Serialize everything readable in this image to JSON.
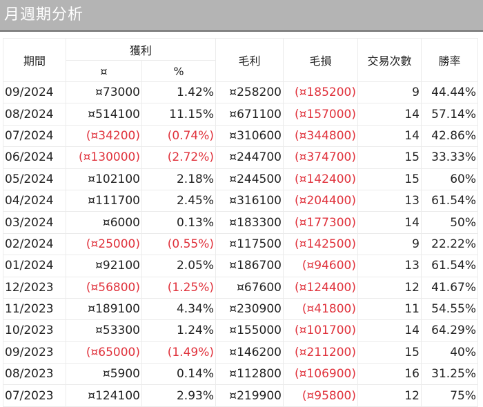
{
  "title": "月週期分析",
  "headers": {
    "period": "期間",
    "profit": "獲利",
    "profit_amount": "¤",
    "profit_pct": "%",
    "gross_profit": "毛利",
    "gross_loss": "毛損",
    "trades": "交易次數",
    "win_rate": "勝率"
  },
  "colors": {
    "negative": "#e0323c",
    "title_bg": "#b4b4b4"
  },
  "rows": [
    {
      "period": "09/2024",
      "amount": "¤73000",
      "pct": "1.42%",
      "gp": "¤258200",
      "gl": "(¤185200)",
      "trades": "9",
      "win": "44.44%",
      "neg": false
    },
    {
      "period": "08/2024",
      "amount": "¤514100",
      "pct": "11.15%",
      "gp": "¤671100",
      "gl": "(¤157000)",
      "trades": "14",
      "win": "57.14%",
      "neg": false
    },
    {
      "period": "07/2024",
      "amount": "(¤34200)",
      "pct": "(0.74%)",
      "gp": "¤310600",
      "gl": "(¤344800)",
      "trades": "14",
      "win": "42.86%",
      "neg": true
    },
    {
      "period": "06/2024",
      "amount": "(¤130000)",
      "pct": "(2.72%)",
      "gp": "¤244700",
      "gl": "(¤374700)",
      "trades": "15",
      "win": "33.33%",
      "neg": true
    },
    {
      "period": "05/2024",
      "amount": "¤102100",
      "pct": "2.18%",
      "gp": "¤244500",
      "gl": "(¤142400)",
      "trades": "15",
      "win": "60%",
      "neg": false
    },
    {
      "period": "04/2024",
      "amount": "¤111700",
      "pct": "2.45%",
      "gp": "¤316100",
      "gl": "(¤204400)",
      "trades": "13",
      "win": "61.54%",
      "neg": false
    },
    {
      "period": "03/2024",
      "amount": "¤6000",
      "pct": "0.13%",
      "gp": "¤183300",
      "gl": "(¤177300)",
      "trades": "14",
      "win": "50%",
      "neg": false
    },
    {
      "period": "02/2024",
      "amount": "(¤25000)",
      "pct": "(0.55%)",
      "gp": "¤117500",
      "gl": "(¤142500)",
      "trades": "9",
      "win": "22.22%",
      "neg": true
    },
    {
      "period": "01/2024",
      "amount": "¤92100",
      "pct": "2.05%",
      "gp": "¤186700",
      "gl": "(¤94600)",
      "trades": "13",
      "win": "61.54%",
      "neg": false
    },
    {
      "period": "12/2023",
      "amount": "(¤56800)",
      "pct": "(1.25%)",
      "gp": "¤67600",
      "gl": "(¤124400)",
      "trades": "12",
      "win": "41.67%",
      "neg": true
    },
    {
      "period": "11/2023",
      "amount": "¤189100",
      "pct": "4.34%",
      "gp": "¤230900",
      "gl": "(¤41800)",
      "trades": "11",
      "win": "54.55%",
      "neg": false
    },
    {
      "period": "10/2023",
      "amount": "¤53300",
      "pct": "1.24%",
      "gp": "¤155000",
      "gl": "(¤101700)",
      "trades": "14",
      "win": "64.29%",
      "neg": false
    },
    {
      "period": "09/2023",
      "amount": "(¤65000)",
      "pct": "(1.49%)",
      "gp": "¤146200",
      "gl": "(¤211200)",
      "trades": "15",
      "win": "40%",
      "neg": true
    },
    {
      "period": "08/2023",
      "amount": "¤5900",
      "pct": "0.14%",
      "gp": "¤112800",
      "gl": "(¤106900)",
      "trades": "16",
      "win": "31.25%",
      "neg": false
    },
    {
      "period": "07/2023",
      "amount": "¤124100",
      "pct": "2.93%",
      "gp": "¤219900",
      "gl": "(¤95800)",
      "trades": "12",
      "win": "75%",
      "neg": false
    }
  ]
}
